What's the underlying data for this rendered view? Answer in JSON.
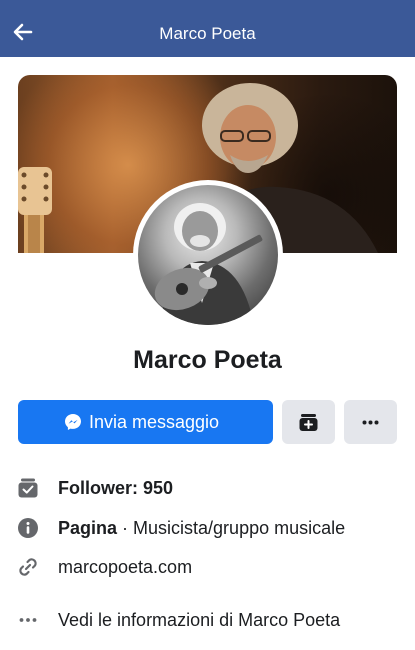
{
  "header": {
    "title": "Marco Poeta",
    "back_icon": "arrow-left-icon",
    "background": "#3b5998"
  },
  "profile": {
    "name": "Marco Poeta",
    "cover_image": "cover-photo",
    "avatar_image": "profile-photo"
  },
  "actions": {
    "message_label": "Invia messaggio",
    "message_icon": "messenger-icon",
    "follow_icon": "follow-page-icon",
    "more_icon": "more-horizontal-icon",
    "primary_color": "#1877f2",
    "secondary_color": "#e4e6eb"
  },
  "info": {
    "followers": "Follower: 950",
    "page_label": "Pagina",
    "separator": " · ",
    "category": "Musicista/gruppo musicale",
    "website": "marcopoeta.com",
    "see_more": "Vedi le informazioni di Marco Poeta"
  }
}
